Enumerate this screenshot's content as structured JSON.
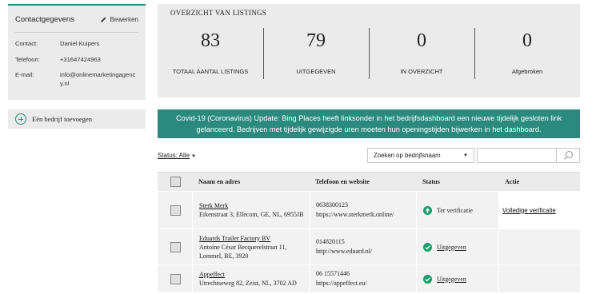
{
  "contact": {
    "title": "Contactgegevens",
    "edit_label": "Bewerken",
    "rows": [
      {
        "label": "Contact:",
        "value": "Daniel Kuipers"
      },
      {
        "label": "Telefoon:",
        "value": "+31647424963"
      },
      {
        "label": "E-mail:",
        "value": "info@onlinemarketingagency.nl"
      }
    ]
  },
  "add_business_label": "Eén bedrijf toevoegen",
  "overview": {
    "title": "OVERZICHT VAN LISTINGS",
    "stats": [
      {
        "value": "83",
        "label": "TOTAAL AANTAL LISTINGS"
      },
      {
        "value": "79",
        "label": "UITGEGEVEN"
      },
      {
        "value": "0",
        "label": "IN OVERZICHT"
      },
      {
        "value": "0",
        "label": "Afgebroken"
      }
    ]
  },
  "banner": {
    "text": "Covid-19 (Coronavirus) Update: Bing Places heeft linksonder in het bedrijfsdashboard een nieuwe tijdelijk gesloten link gelanceerd. Bedrijven met tijdelijk gewijzigde uren moeten hun openingstijden bijwerken in het dashboard."
  },
  "filters": {
    "status_label": "Status: Alle",
    "search_type": "Zoeken op bedrijfsnaam",
    "search_value": ""
  },
  "table": {
    "headers": {
      "name": "Naam en adres",
      "phone": "Telefoon en website",
      "status": "Status",
      "action": "Actie"
    },
    "rows": [
      {
        "name": "Sterk Merk",
        "address": "Eikenstraat 3, Ellecom, GE, NL, 6955JB",
        "phone": "0638300123",
        "website": "https://www.sterkmerk.online/",
        "status": "Ter verificatie",
        "status_type": "pending",
        "action": "Volledige verificatie"
      },
      {
        "name": "Eduards Trailer Factory BV",
        "address": "Antoine César Becquerelstraat 11, Lommel, BE, 3920",
        "phone": "014820115",
        "website": "http://www.eduard.nl/",
        "status": "Uitgegeven",
        "status_type": "published",
        "action": ""
      },
      {
        "name": "Appeffect",
        "address": "Utrechtseweg 82, Zeist, NL, 3702 AD",
        "phone": "06 15571446",
        "website": "https://appeffect.eu/",
        "status": "Uitgegeven",
        "status_type": "published",
        "action": ""
      }
    ]
  },
  "colors": {
    "accent": "#2b8a7e",
    "panel": "#ebebeb",
    "status_green": "#1a9c6b"
  }
}
